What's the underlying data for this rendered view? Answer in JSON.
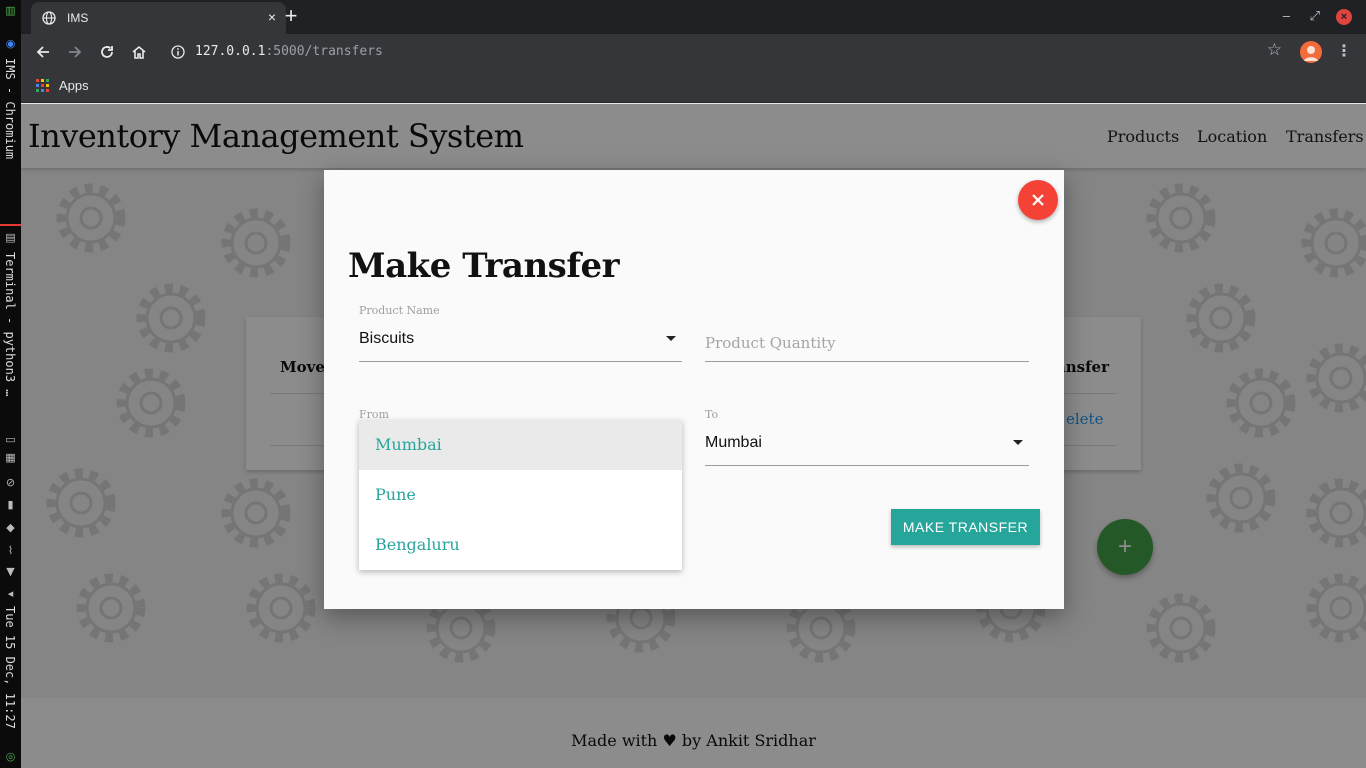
{
  "system_bar": {
    "window_title": "IMS - Chromium",
    "terminal_title": "Terminal - python3 …",
    "clock": "Tue 15 Dec, 11:27"
  },
  "browser": {
    "tab_title": "IMS",
    "tab_close": "×",
    "new_tab": "+",
    "url_host": "127.0.0.1",
    "url_path": ":5000/transfers",
    "bookmarks_apps": "Apps",
    "window_min": "–",
    "window_max": "⤢",
    "window_close": "×"
  },
  "site": {
    "brand": "Inventory Management System",
    "nav": [
      "Products",
      "Location",
      "Transfers"
    ]
  },
  "table": {
    "header_left": "Movem",
    "header_right": "ansfer",
    "row_action": "elete"
  },
  "fab": {
    "label": "+"
  },
  "footer": {
    "prefix": "Made with",
    "heart": "♥",
    "suffix": "by Ankit Sridhar"
  },
  "modal": {
    "title": "Make Transfer",
    "product_name": {
      "label": "Product Name",
      "value": "Biscuits"
    },
    "product_quantity": {
      "placeholder": "Product Quantity"
    },
    "from": {
      "label": "From",
      "options": [
        "Mumbai",
        "Pune",
        "Bengaluru"
      ],
      "highlighted": "Mumbai"
    },
    "to": {
      "label": "To",
      "value": "Mumbai"
    },
    "submit_label": "MAKE TRANSFER"
  },
  "colors": {
    "accent_teal": "#26a69a",
    "close_red": "#f44336",
    "fab_green": "#43a047",
    "link_blue": "#2196f3"
  }
}
